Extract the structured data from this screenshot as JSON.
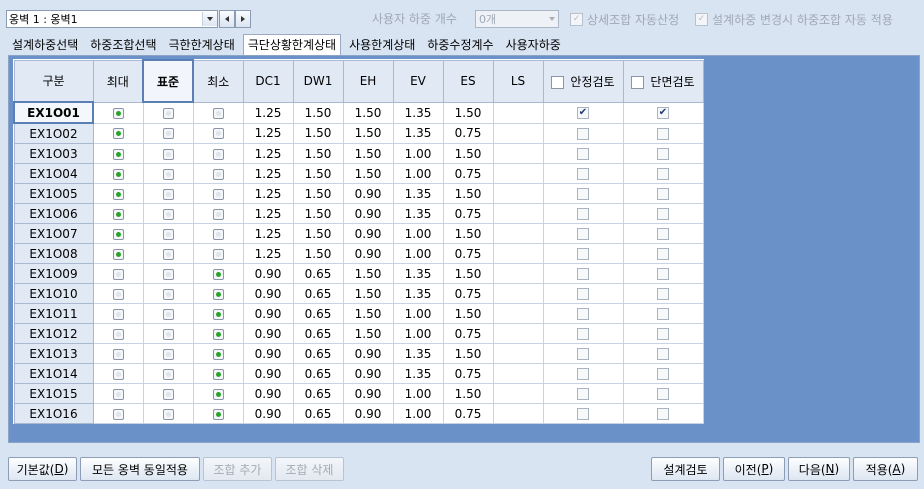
{
  "top": {
    "wall_select_value": "옹벽 1 : 옹벽1",
    "user_load_count_label": "사용자 하중 개수",
    "user_load_count_value": "0개",
    "auto_detail_combo_label": "상세조합 자동산정",
    "auto_apply_label": "설계하중 변경시 하중조합 자동 적용"
  },
  "tabs": [
    {
      "label": "설계하중선택",
      "active": false
    },
    {
      "label": "하중조합선택",
      "active": false
    },
    {
      "label": "극한한계상태",
      "active": false
    },
    {
      "label": "극단상황한계상태",
      "active": true
    },
    {
      "label": "사용한계상태",
      "active": false
    },
    {
      "label": "하중수정계수",
      "active": false
    },
    {
      "label": "사용자하중",
      "active": false
    }
  ],
  "grid": {
    "headers": {
      "id": "구분",
      "max": "최대",
      "std": "표준",
      "min": "최소",
      "dc1": "DC1",
      "dw1": "DW1",
      "eh": "EH",
      "ev": "EV",
      "es": "ES",
      "ls": "LS",
      "stability": "안정검토",
      "section": "단면검토"
    },
    "rows": [
      {
        "id": "EX1O01",
        "radio": "max",
        "dc1": "1.25",
        "dw1": "1.50",
        "eh": "1.50",
        "ev": "1.35",
        "es": "1.50",
        "ls": "",
        "stab": true,
        "sec": true
      },
      {
        "id": "EX1O02",
        "radio": "max",
        "dc1": "1.25",
        "dw1": "1.50",
        "eh": "1.50",
        "ev": "1.35",
        "es": "0.75",
        "ls": "",
        "stab": false,
        "sec": false
      },
      {
        "id": "EX1O03",
        "radio": "max",
        "dc1": "1.25",
        "dw1": "1.50",
        "eh": "1.50",
        "ev": "1.00",
        "es": "1.50",
        "ls": "",
        "stab": false,
        "sec": false
      },
      {
        "id": "EX1O04",
        "radio": "max",
        "dc1": "1.25",
        "dw1": "1.50",
        "eh": "1.50",
        "ev": "1.00",
        "es": "0.75",
        "ls": "",
        "stab": false,
        "sec": false
      },
      {
        "id": "EX1O05",
        "radio": "max",
        "dc1": "1.25",
        "dw1": "1.50",
        "eh": "0.90",
        "ev": "1.35",
        "es": "1.50",
        "ls": "",
        "stab": false,
        "sec": false
      },
      {
        "id": "EX1O06",
        "radio": "max",
        "dc1": "1.25",
        "dw1": "1.50",
        "eh": "0.90",
        "ev": "1.35",
        "es": "0.75",
        "ls": "",
        "stab": false,
        "sec": false
      },
      {
        "id": "EX1O07",
        "radio": "max",
        "dc1": "1.25",
        "dw1": "1.50",
        "eh": "0.90",
        "ev": "1.00",
        "es": "1.50",
        "ls": "",
        "stab": false,
        "sec": false
      },
      {
        "id": "EX1O08",
        "radio": "max",
        "dc1": "1.25",
        "dw1": "1.50",
        "eh": "0.90",
        "ev": "1.00",
        "es": "0.75",
        "ls": "",
        "stab": false,
        "sec": false
      },
      {
        "id": "EX1O09",
        "radio": "min",
        "dc1": "0.90",
        "dw1": "0.65",
        "eh": "1.50",
        "ev": "1.35",
        "es": "1.50",
        "ls": "",
        "stab": false,
        "sec": false
      },
      {
        "id": "EX1O10",
        "radio": "min",
        "dc1": "0.90",
        "dw1": "0.65",
        "eh": "1.50",
        "ev": "1.35",
        "es": "0.75",
        "ls": "",
        "stab": false,
        "sec": false
      },
      {
        "id": "EX1O11",
        "radio": "min",
        "dc1": "0.90",
        "dw1": "0.65",
        "eh": "1.50",
        "ev": "1.00",
        "es": "1.50",
        "ls": "",
        "stab": false,
        "sec": false
      },
      {
        "id": "EX1O12",
        "radio": "min",
        "dc1": "0.90",
        "dw1": "0.65",
        "eh": "1.50",
        "ev": "1.00",
        "es": "0.75",
        "ls": "",
        "stab": false,
        "sec": false
      },
      {
        "id": "EX1O13",
        "radio": "min",
        "dc1": "0.90",
        "dw1": "0.65",
        "eh": "0.90",
        "ev": "1.35",
        "es": "1.50",
        "ls": "",
        "stab": false,
        "sec": false
      },
      {
        "id": "EX1O14",
        "radio": "min",
        "dc1": "0.90",
        "dw1": "0.65",
        "eh": "0.90",
        "ev": "1.35",
        "es": "0.75",
        "ls": "",
        "stab": false,
        "sec": false
      },
      {
        "id": "EX1O15",
        "radio": "min",
        "dc1": "0.90",
        "dw1": "0.65",
        "eh": "0.90",
        "ev": "1.00",
        "es": "1.50",
        "ls": "",
        "stab": false,
        "sec": false
      },
      {
        "id": "EX1O16",
        "radio": "min",
        "dc1": "0.90",
        "dw1": "0.65",
        "eh": "0.90",
        "ev": "1.00",
        "es": "0.75",
        "ls": "",
        "stab": false,
        "sec": false
      }
    ]
  },
  "buttons": {
    "default": "기본값(",
    "default_key": "D",
    "default_end": ")",
    "apply_all": "모든 옹벽 동일적용",
    "add_combo": "조합 추가",
    "delete_combo": "조합 삭제",
    "design_check": "설계검토",
    "prev": "이전(",
    "prev_key": "P",
    "prev_end": ")",
    "next": "다음(",
    "next_key": "N",
    "next_end": ")",
    "apply": "적용(",
    "apply_key": "A",
    "apply_end": ")"
  },
  "colors": {
    "panel_bg": "#6b92c8",
    "radio_selected": "#29a329"
  }
}
